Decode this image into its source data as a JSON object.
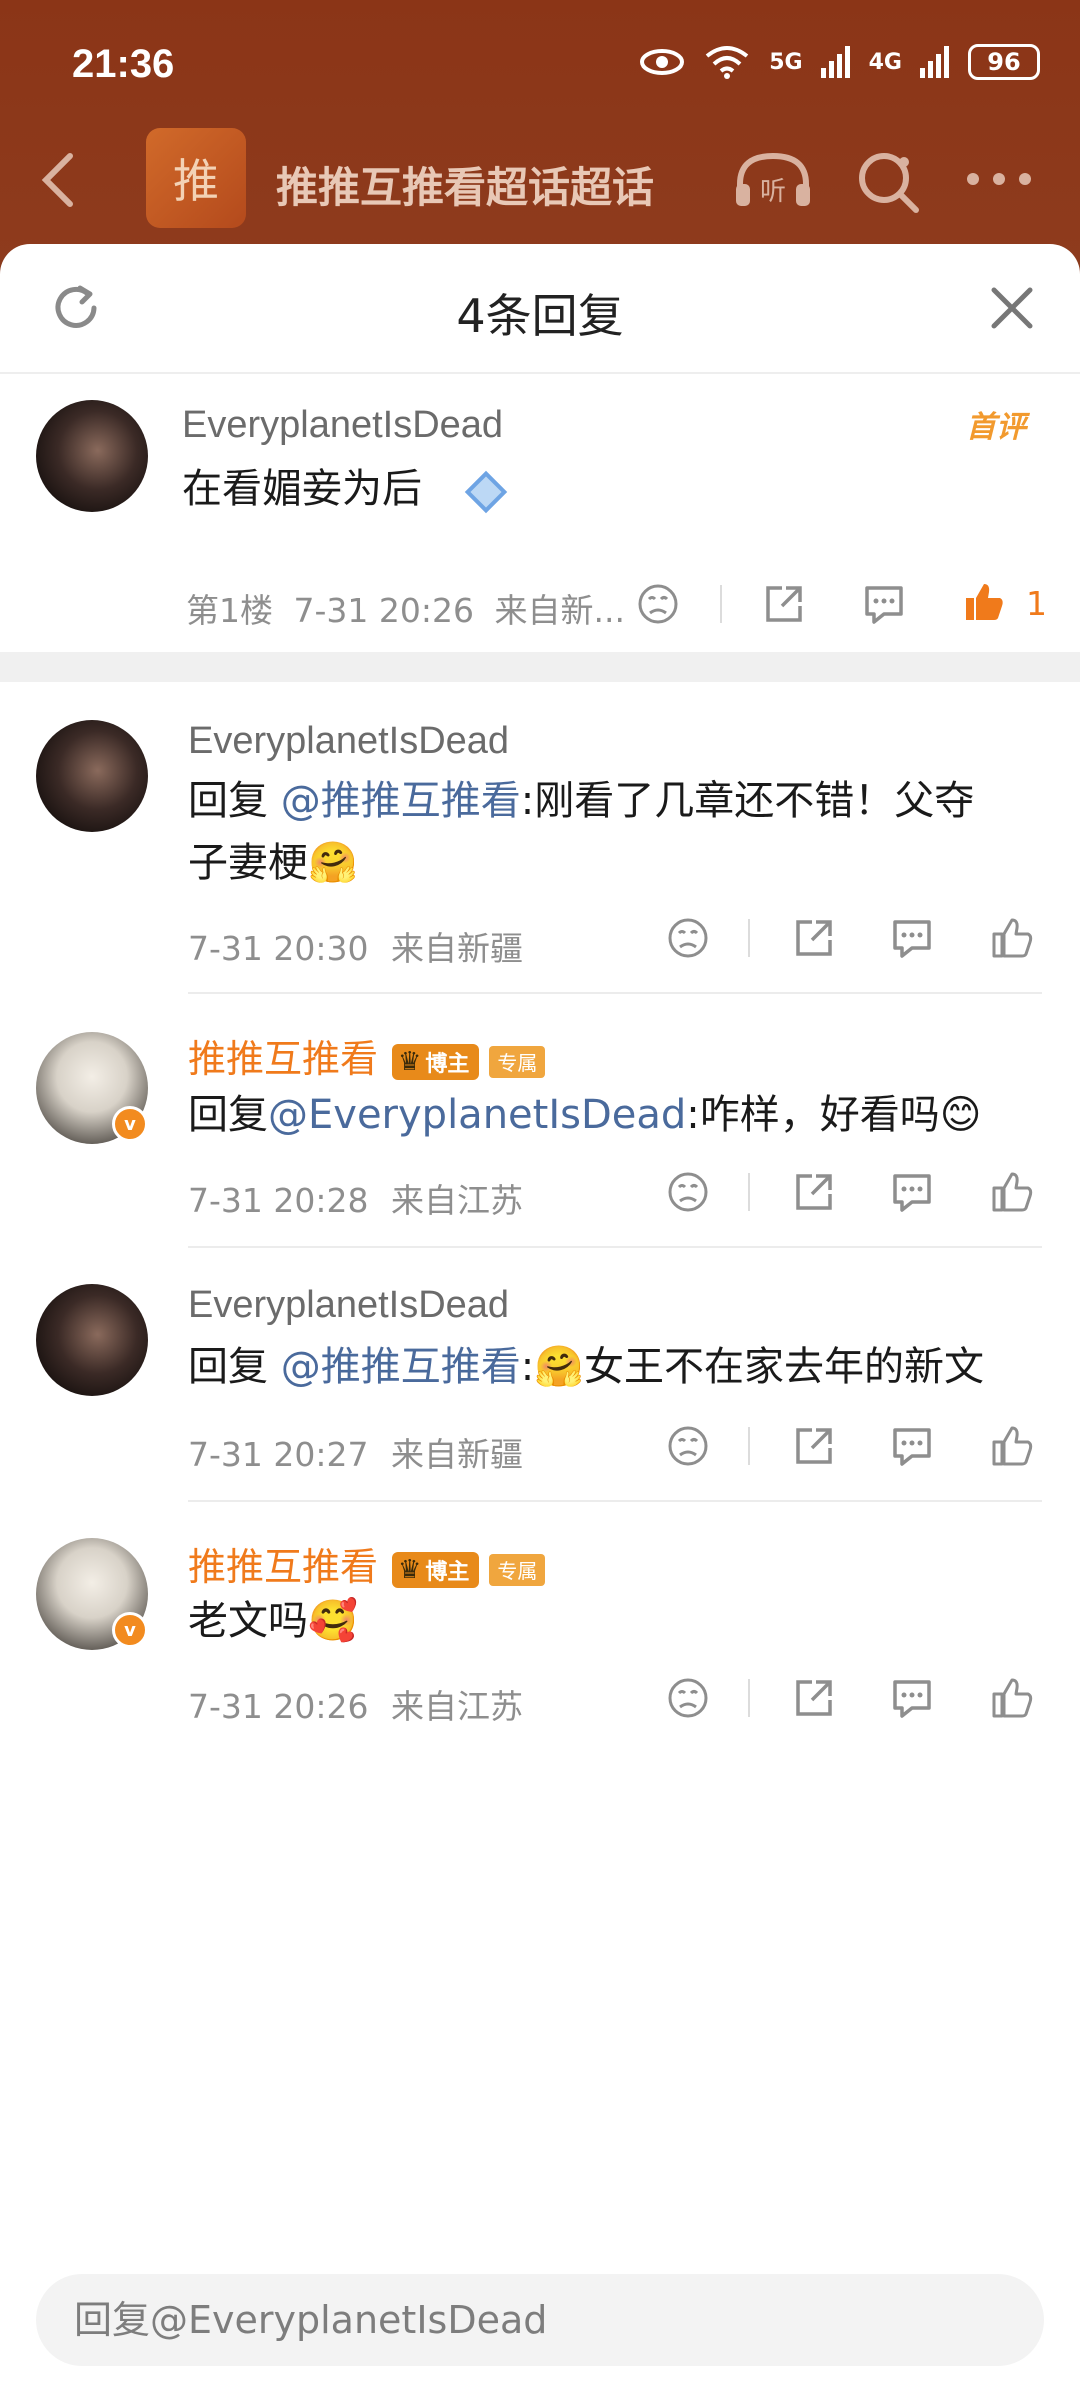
{
  "status_bar": {
    "time": "21:36",
    "signal_5g": "5G",
    "signal_4g": "4G",
    "battery": "96"
  },
  "header": {
    "logo_char": "推",
    "title": "推推互推看超话超话"
  },
  "sheet": {
    "title": "4条回复"
  },
  "first_comment": {
    "username": "EveryplanetIsDead",
    "text": "在看媚妾为后",
    "badge": "首评",
    "floor": "第1楼",
    "time": "7-31 20:26",
    "source": "来自新...",
    "likes": "1"
  },
  "replies": [
    {
      "username": "EveryplanetIsDead",
      "reply_prefix": "回复 ",
      "mention": "@推推互推看",
      "text": ":刚看了几章还不错！父夺",
      "text_line2": "子妻梗🤗",
      "time": "7-31 20:30",
      "source": "来自新疆"
    },
    {
      "username": "推推互推看",
      "tag_boss": "博主",
      "tag_exclusive": "专属",
      "reply_prefix": "回复",
      "mention": "@EveryplanetIsDead",
      "text": ":咋样，好看吗😊",
      "time": "7-31 20:28",
      "source": "来自江苏"
    },
    {
      "username": "EveryplanetIsDead",
      "reply_prefix": "回复 ",
      "mention": "@推推互推看",
      "text": ":🤗女王不在家去年的新文",
      "time": "7-31 20:27",
      "source": "来自新疆"
    },
    {
      "username": "推推互推看",
      "tag_boss": "博主",
      "tag_exclusive": "专属",
      "text": "老文吗🥰",
      "time": "7-31 20:26",
      "source": "来自江苏"
    }
  ],
  "reply_input": {
    "placeholder": "回复@EveryplanetIsDead"
  },
  "colors": {
    "accent": "#f07a1b",
    "mention": "#4a6a9c",
    "header_bg": "#8b3517"
  }
}
